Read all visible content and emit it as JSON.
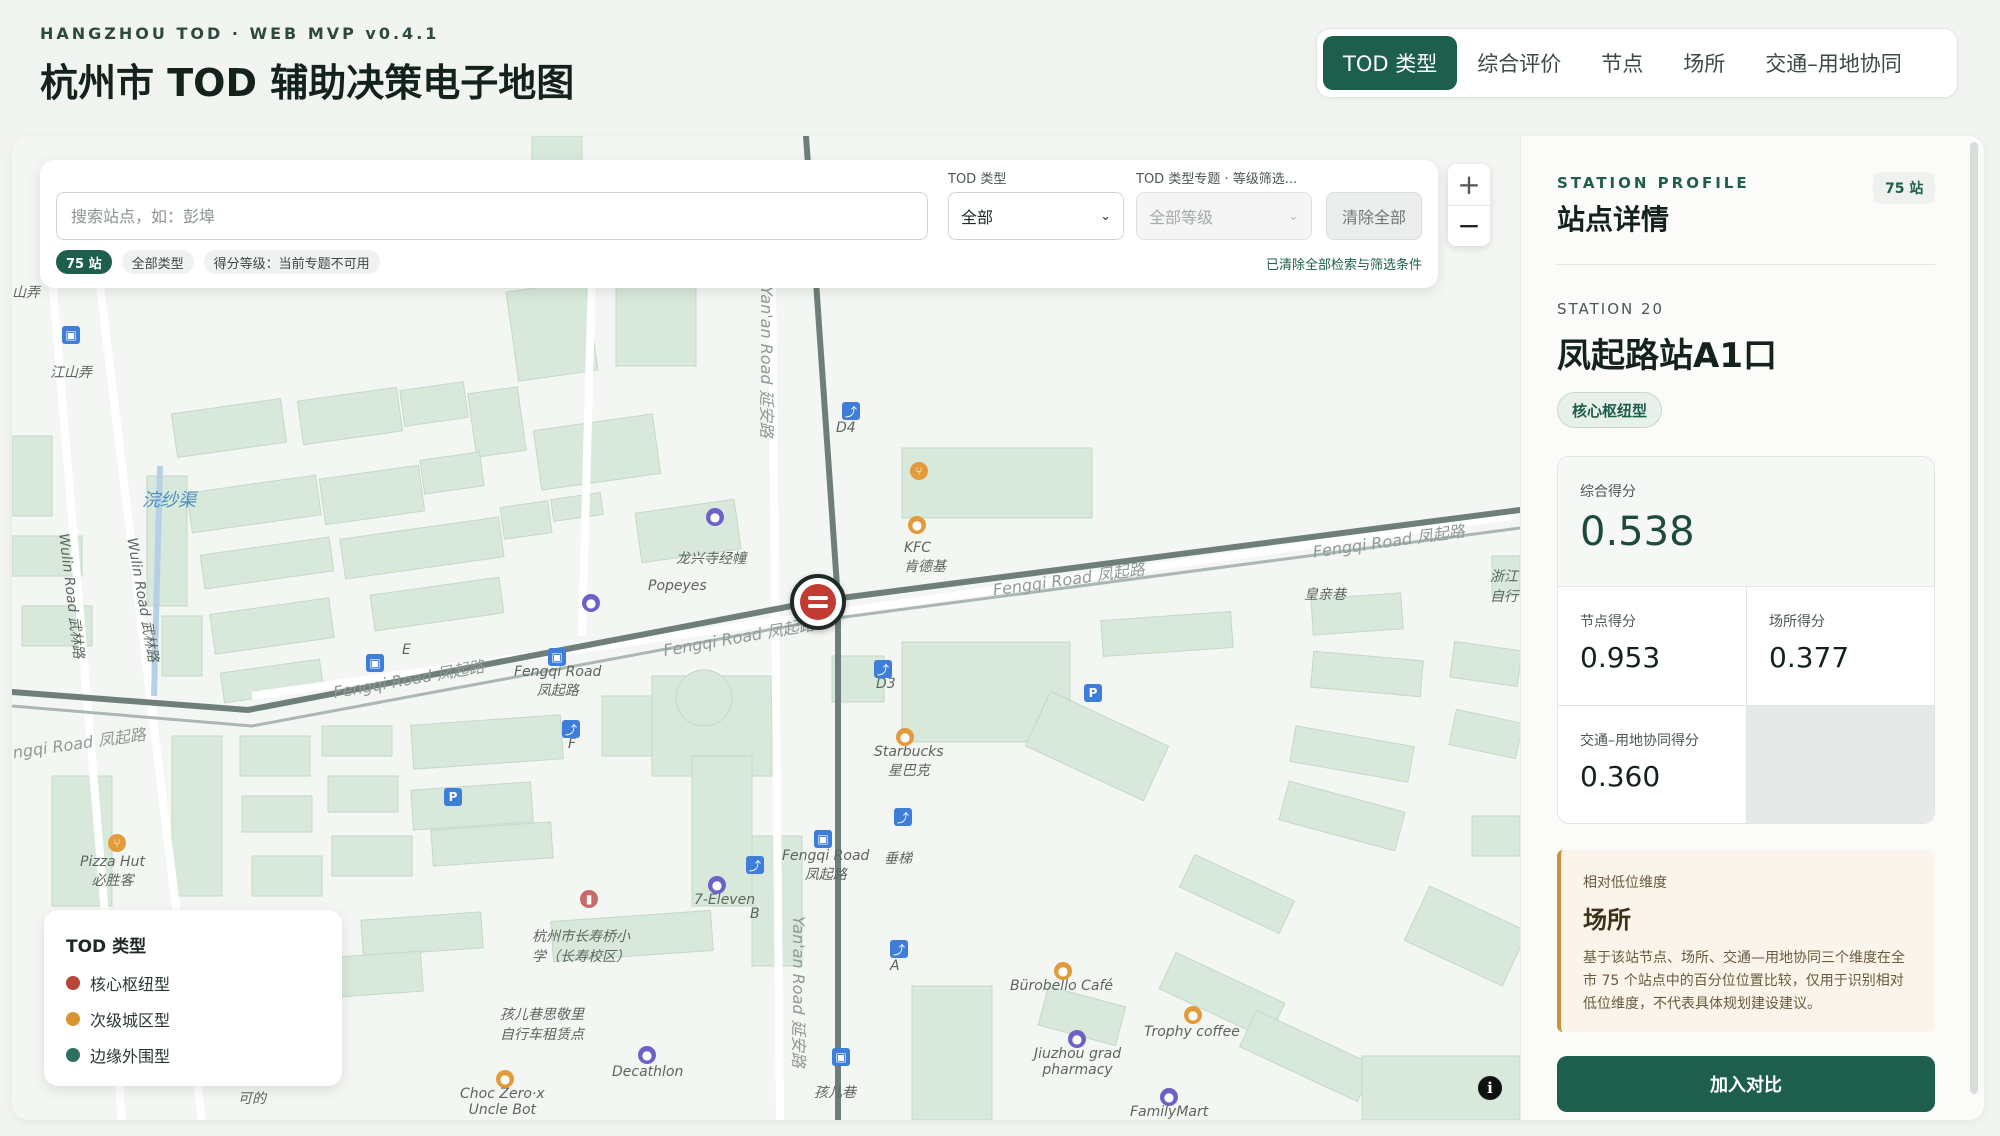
{
  "header": {
    "eyebrow": "HANGZHOU TOD · WEB MVP v0.4.1",
    "title": "杭州市 TOD 辅助决策电子地图",
    "tabs": [
      {
        "label": "TOD 类型",
        "active": true
      },
      {
        "label": "综合评价",
        "active": false
      },
      {
        "label": "节点",
        "active": false
      },
      {
        "label": "场所",
        "active": false
      },
      {
        "label": "交通–用地协同",
        "active": false
      }
    ]
  },
  "search": {
    "placeholder": "搜索站点，如：彭埠",
    "type_label": "TOD 类型",
    "type_value": "全部",
    "grade_label": "TOD 类型专题 · 等级筛选...",
    "grade_value": "全部等级",
    "clear_button": "清除全部",
    "chips": [
      "75 站",
      "全部类型",
      "得分等级：当前专题不可用"
    ],
    "clear_note": "已清除全部检索与筛选条件"
  },
  "zoom": {
    "in": "+",
    "out": "−"
  },
  "legend": {
    "title": "TOD 类型",
    "items": [
      {
        "label": "核心枢纽型",
        "color": "#b8453b"
      },
      {
        "label": "次级城区型",
        "color": "#d7962f"
      },
      {
        "label": "边缘外围型",
        "color": "#2f6f63"
      }
    ]
  },
  "map_labels": {
    "jiangshan": "江山弄",
    "wulin_road": "Wulin Road 武林路",
    "wansha": "浣纱渠",
    "longxing": "龙兴寺经幢",
    "popeyes": "Popeyes",
    "kfc": "KFC\n肯德基",
    "fengqi_1": "Fengqi Road 凤起路",
    "fengqi_2": "Fengqi Road 凤起路",
    "fengqi_3": "Fengqi Road 凤起路",
    "fengqi_4": "Fengqi Road 凤起路",
    "fengqi_5": "ngqi Road 凤起路",
    "yanan_road": "Yan'an Road 延安路",
    "huangqin": "皇亲巷",
    "starbucks": "Starbucks\n星巴克",
    "d3": "D3",
    "d4": "D4",
    "f": "F",
    "e": "E",
    "b": "B",
    "a": "A",
    "pizza_hut": "Pizza Hut\n必胜客",
    "seven_eleven": "7-Eleven",
    "school": "杭州市长寿桥小学（长寿校区）",
    "bike": "孩儿巷思敬里\n自行车租赁点",
    "decathlon": "Decathlon",
    "burobello": "Bürobello Café",
    "trophy": "Trophy coffee",
    "jiuzhou": "Jiuzhou grad\npharmacy",
    "choc": "Choc Zero·x\nUncle Bot",
    "haier": "孩儿巷",
    "familymart": "FamilyMart",
    "keyi": "可的",
    "fengqi_stop": "Fengqi Road\n凤起路",
    "fengqi_stop2": "Fengqi Road\n凤起路",
    "zhejiang": "浙江\n自行",
    "chuitI": "垂梯",
    "shannong": "山弄"
  },
  "panel": {
    "eyebrow": "STATION PROFILE",
    "title": "站点详情",
    "count_badge": "75 站",
    "station_no": "STATION 20",
    "station_name": "凤起路站A1口",
    "type_badge": "核心枢纽型",
    "scores": {
      "overall_label": "综合得分",
      "overall": "0.538",
      "node_label": "节点得分",
      "node": "0.953",
      "place_label": "场所得分",
      "place": "0.377",
      "synergy_label": "交通–用地协同得分",
      "synergy": "0.360"
    },
    "low_dim": {
      "label": "相对低位维度",
      "value": "场所",
      "note": "基于该站节点、场所、交通—用地协同三个维度在全市 75 个站点中的百分位位置比较，仅用于识别相对低位维度，不代表具体规划建设建议。"
    },
    "compare_button": "加入对比"
  },
  "icons": {
    "info": "info-icon",
    "station": "metro-station-icon",
    "bus": "bus-stop-icon",
    "parking": "parking-icon",
    "restaurant": "restaurant-icon",
    "cafe": "cafe-icon",
    "shop": "shop-icon",
    "exit": "subway-exit-icon"
  },
  "colors": {
    "accent": "#1d5e4c",
    "map_bg": "#f4f6f3",
    "building": "#d8e8da",
    "road": "#6e7f7a",
    "warning_bg": "#fbf4ea",
    "warning_border": "#c8923f"
  }
}
